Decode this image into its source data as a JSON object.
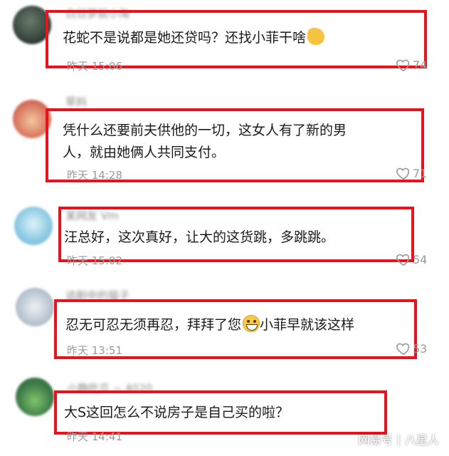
{
  "comments": [
    {
      "username": "白日梦就小淘",
      "text": "花蛇不是说都是她还贷吗？还找小菲干啥",
      "emoji": "raised-fist-emoji",
      "time": "昨天 15:06",
      "likes": "74"
    },
    {
      "username": "草妈",
      "text_line1": "凭什么还要前夫供他的一切，这女人有了新的男",
      "text_line2": "人，就由她俩人共同支付。",
      "time": "昨天 14:28",
      "likes": "71"
    },
    {
      "username": "某网友 Vm",
      "text": "汪总好，这次真好，让大的这货跳，多跳跳。",
      "time": "昨天 15:02",
      "likes": "54"
    },
    {
      "username": "追剧中的猫子",
      "text_before": "忍无可忍无须再忍，拜拜了您",
      "emoji": "grinning-emoji",
      "text_after": "小菲早就该这样",
      "time": "昨天 13:51",
      "likes": "53"
    },
    {
      "username": "小静吃瓜 ~ 4020",
      "text": "大S这回怎么不说房子是自己买的啦？",
      "time": "昨天 14:41"
    }
  ],
  "watermark": {
    "left": "网易号",
    "separator": "|",
    "right": "八星人"
  },
  "colors": {
    "highlight_box": "#e8131c",
    "meta_text": "#9a9a9a"
  }
}
